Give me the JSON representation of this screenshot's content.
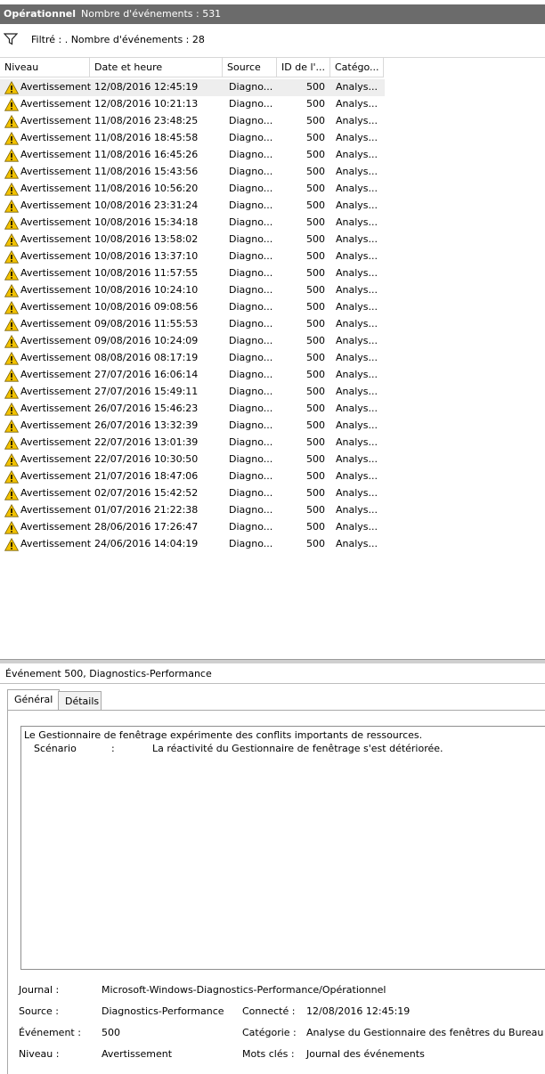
{
  "title": {
    "log_name": "Opérationnel",
    "event_count": "Nombre d'événements : 531"
  },
  "filter": {
    "text": "Filtré : . Nombre d'événements : 28",
    "icon": "funnel-icon"
  },
  "columns": [
    "Niveau",
    "Date et heure",
    "Source",
    "ID de l'...",
    "Catégo..."
  ],
  "events": [
    {
      "level": "Avertissement",
      "date": "12/08/2016 12:45:19",
      "source": "Diagno...",
      "id": "500",
      "category": "Analys..."
    },
    {
      "level": "Avertissement",
      "date": "12/08/2016 10:21:13",
      "source": "Diagno...",
      "id": "500",
      "category": "Analys..."
    },
    {
      "level": "Avertissement",
      "date": "11/08/2016 23:48:25",
      "source": "Diagno...",
      "id": "500",
      "category": "Analys..."
    },
    {
      "level": "Avertissement",
      "date": "11/08/2016 18:45:58",
      "source": "Diagno...",
      "id": "500",
      "category": "Analys..."
    },
    {
      "level": "Avertissement",
      "date": "11/08/2016 16:45:26",
      "source": "Diagno...",
      "id": "500",
      "category": "Analys..."
    },
    {
      "level": "Avertissement",
      "date": "11/08/2016 15:43:56",
      "source": "Diagno...",
      "id": "500",
      "category": "Analys..."
    },
    {
      "level": "Avertissement",
      "date": "11/08/2016 10:56:20",
      "source": "Diagno...",
      "id": "500",
      "category": "Analys..."
    },
    {
      "level": "Avertissement",
      "date": "10/08/2016 23:31:24",
      "source": "Diagno...",
      "id": "500",
      "category": "Analys..."
    },
    {
      "level": "Avertissement",
      "date": "10/08/2016 15:34:18",
      "source": "Diagno...",
      "id": "500",
      "category": "Analys..."
    },
    {
      "level": "Avertissement",
      "date": "10/08/2016 13:58:02",
      "source": "Diagno...",
      "id": "500",
      "category": "Analys..."
    },
    {
      "level": "Avertissement",
      "date": "10/08/2016 13:37:10",
      "source": "Diagno...",
      "id": "500",
      "category": "Analys..."
    },
    {
      "level": "Avertissement",
      "date": "10/08/2016 11:57:55",
      "source": "Diagno...",
      "id": "500",
      "category": "Analys..."
    },
    {
      "level": "Avertissement",
      "date": "10/08/2016 10:24:10",
      "source": "Diagno...",
      "id": "500",
      "category": "Analys..."
    },
    {
      "level": "Avertissement",
      "date": "10/08/2016 09:08:56",
      "source": "Diagno...",
      "id": "500",
      "category": "Analys..."
    },
    {
      "level": "Avertissement",
      "date": "09/08/2016 11:55:53",
      "source": "Diagno...",
      "id": "500",
      "category": "Analys..."
    },
    {
      "level": "Avertissement",
      "date": "09/08/2016 10:24:09",
      "source": "Diagno...",
      "id": "500",
      "category": "Analys..."
    },
    {
      "level": "Avertissement",
      "date": "08/08/2016 08:17:19",
      "source": "Diagno...",
      "id": "500",
      "category": "Analys..."
    },
    {
      "level": "Avertissement",
      "date": "27/07/2016 16:06:14",
      "source": "Diagno...",
      "id": "500",
      "category": "Analys..."
    },
    {
      "level": "Avertissement",
      "date": "27/07/2016 15:49:11",
      "source": "Diagno...",
      "id": "500",
      "category": "Analys..."
    },
    {
      "level": "Avertissement",
      "date": "26/07/2016 15:46:23",
      "source": "Diagno...",
      "id": "500",
      "category": "Analys..."
    },
    {
      "level": "Avertissement",
      "date": "26/07/2016 13:32:39",
      "source": "Diagno...",
      "id": "500",
      "category": "Analys..."
    },
    {
      "level": "Avertissement",
      "date": "22/07/2016 13:01:39",
      "source": "Diagno...",
      "id": "500",
      "category": "Analys..."
    },
    {
      "level": "Avertissement",
      "date": "22/07/2016 10:30:50",
      "source": "Diagno...",
      "id": "500",
      "category": "Analys..."
    },
    {
      "level": "Avertissement",
      "date": "21/07/2016 18:47:06",
      "source": "Diagno...",
      "id": "500",
      "category": "Analys..."
    },
    {
      "level": "Avertissement",
      "date": "02/07/2016 15:42:52",
      "source": "Diagno...",
      "id": "500",
      "category": "Analys..."
    },
    {
      "level": "Avertissement",
      "date": "01/07/2016 21:22:38",
      "source": "Diagno...",
      "id": "500",
      "category": "Analys..."
    },
    {
      "level": "Avertissement",
      "date": "28/06/2016 17:26:47",
      "source": "Diagno...",
      "id": "500",
      "category": "Analys..."
    },
    {
      "level": "Avertissement",
      "date": "24/06/2016 14:04:19",
      "source": "Diagno...",
      "id": "500",
      "category": "Analys..."
    }
  ],
  "detail": {
    "title": "Événement 500, Diagnostics-Performance",
    "tabs": [
      "Général",
      "Détails"
    ],
    "message": {
      "line1": "Le Gestionnaire de fenêtrage expérimente des conflits importants de ressources.",
      "scenario_label": "Scénario",
      "separator": ":",
      "scenario_value": "La réactivité du Gestionnaire de fenêtrage s'est détériorée."
    },
    "props": {
      "journal_label": "Journal :",
      "journal_value": "Microsoft-Windows-Diagnostics-Performance/Opérationnel",
      "source_label": "Source :",
      "source_value": "Diagnostics-Performance",
      "connected_label": "Connecté :",
      "connected_value": "12/08/2016 12:45:19",
      "event_label": "Événement :",
      "event_value": "500",
      "category_label": "Catégorie :",
      "category_value": "Analyse du Gestionnaire des fenêtres du Bureau",
      "level_label": "Niveau :",
      "level_value": "Avertissement",
      "keywords_label": "Mots clés :",
      "keywords_value": "Journal des événements"
    }
  },
  "colors": {
    "titlebar": "#6b6b6b",
    "selected_row": "#eeeeee",
    "warning": "#f2c200"
  }
}
